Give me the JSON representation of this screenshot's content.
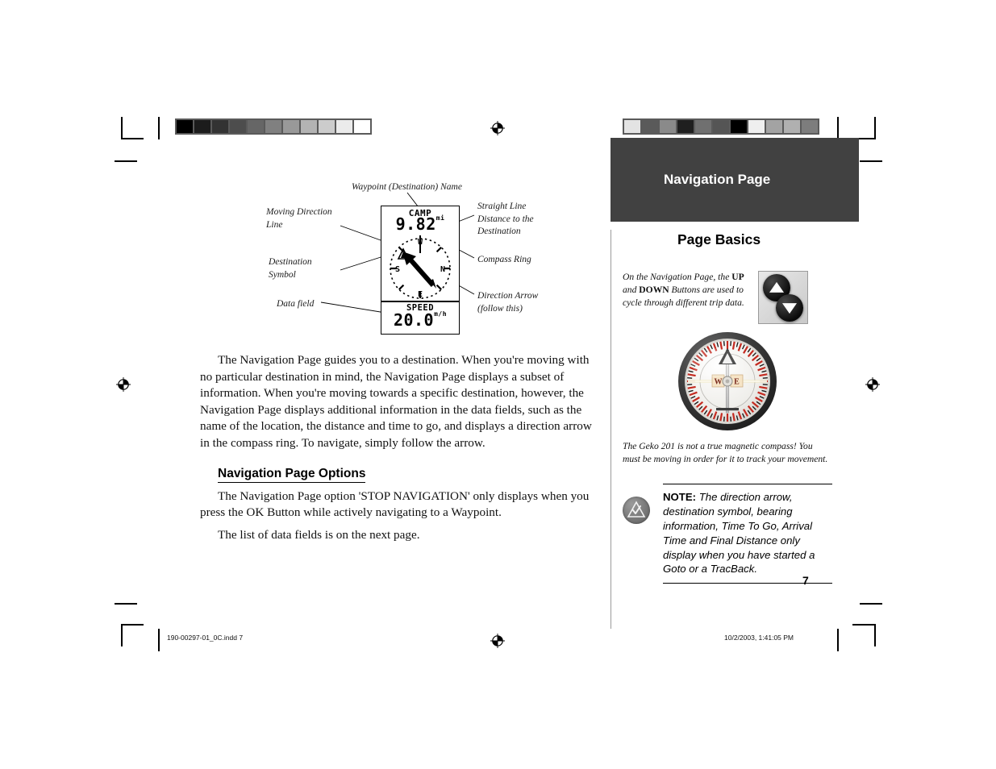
{
  "document": {
    "page_number": "7",
    "chapter_title": "Navigation Page",
    "sidebar_heading": "Page Basics"
  },
  "figure": {
    "device_screen": {
      "waypoint_name": "CAMP",
      "distance_value": "9.82",
      "distance_unit": "mi",
      "compass_labels": {
        "north": "N",
        "south": "S",
        "east": "E",
        "west": "W"
      },
      "data_field_label": "SPEED",
      "data_field_value": "20.0",
      "data_field_unit": "m/h"
    },
    "callouts": {
      "waypoint_name": "Waypoint (Destination) Name",
      "moving_direction_line": "Moving Direction\nLine",
      "destination_symbol": "Destination\nSymbol",
      "data_field": "Data field",
      "straight_line_distance": "Straight Line\nDistance to the\nDestination",
      "compass_ring": "Compass Ring",
      "direction_arrow": "Direction Arrow\n(follow this)"
    }
  },
  "body": {
    "paragraph_1": "The Navigation Page guides you to a destination. When you're moving with no particular destination in mind, the Navigation Page displays a subset of information. When you're moving towards a specific destination, however, the Navigation Page displays additional information in the data fields, such as the name of the location, the distance and time to go, and displays a direction arrow in the compass ring. To navigate, simply follow the arrow.",
    "section_heading": "Navigation Page Options",
    "paragraph_2": "The Navigation Page option 'STOP NAVIGATION' only displays when you press the OK Button while actively navigating to a Waypoint.",
    "paragraph_3": "The list of data fields is on the next page."
  },
  "sidebar": {
    "updown_text_part1": "On the Navigation Page, the ",
    "updown_bold1": "UP",
    "updown_text_part2": " and ",
    "updown_bold2": "DOWN",
    "updown_text_part3": " Buttons are used to cycle through different trip data.",
    "compass_labels": {
      "west": "W",
      "east": "E"
    },
    "compass_caption": "The Geko 201 is not a true magnetic compass! You must be moving in order for it to track your movement.",
    "note_label": "NOTE:",
    "note_text": " The direction arrow, destination symbol, bearing information, Time To Go, Arrival Time and Final Distance only display when you have started a Goto or a TracBack."
  },
  "footer": {
    "file_name": "190-00297-01_0C.indd   7",
    "timestamp": "10/2/2003, 1:41:05 PM"
  },
  "calibration": {
    "left_bar": [
      "#000000",
      "#1c1c1c",
      "#333333",
      "#4d4d4d",
      "#666666",
      "#808080",
      "#999999",
      "#b3b3b3",
      "#cccccc",
      "#ebebeb",
      "#ffffff"
    ],
    "right_bar": [
      "#e3e3e3",
      "#5a5a5a",
      "#8a8a8a",
      "#1f1f1f",
      "#707070",
      "#555555",
      "#000000",
      "#efefef",
      "#a3a3a3",
      "#b0b0b0",
      "#7d7d7d"
    ]
  },
  "colors": {
    "banner_background": "#414141",
    "banner_text": "#ffffff",
    "rule": "#9a9a9a"
  }
}
